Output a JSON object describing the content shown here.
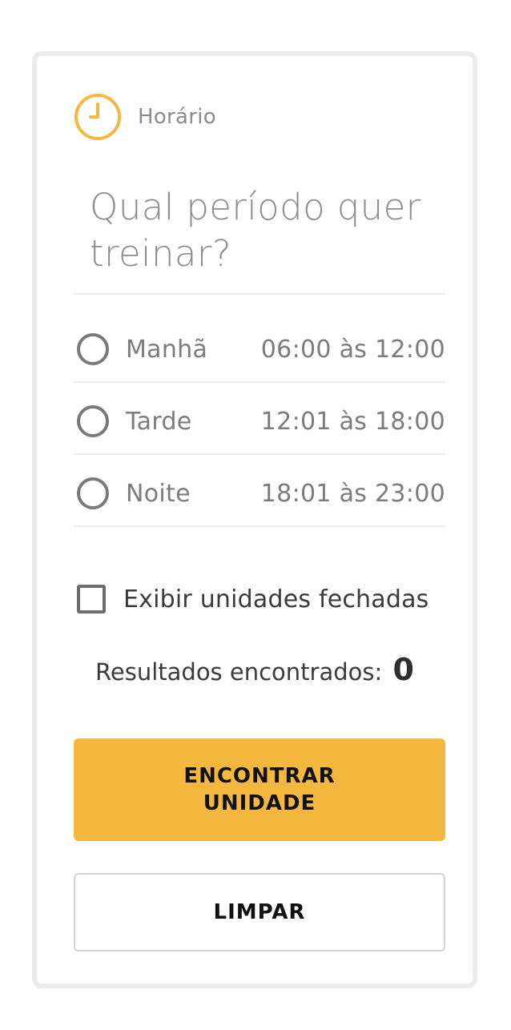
{
  "section": {
    "icon": "clock-icon",
    "label": "Horário"
  },
  "question": "Qual período quer treinar?",
  "periods": [
    {
      "name": "Manhã",
      "time": "06:00 às 12:00",
      "selected": false
    },
    {
      "name": "Tarde",
      "time": "12:01 às 18:00",
      "selected": false
    },
    {
      "name": "Noite",
      "time": "18:01 às 23:00",
      "selected": false
    }
  ],
  "closed_units": {
    "label": "Exibir unidades fechadas",
    "checked": false
  },
  "results": {
    "label": "Resultados encontrados:",
    "count": "0"
  },
  "buttons": {
    "find": "ENCONTRAR UNIDADE",
    "clear": "LIMPAR"
  },
  "colors": {
    "accent": "#f5b83e",
    "text_dark": "#3b3b3b",
    "text_muted": "#7c7c7c"
  }
}
